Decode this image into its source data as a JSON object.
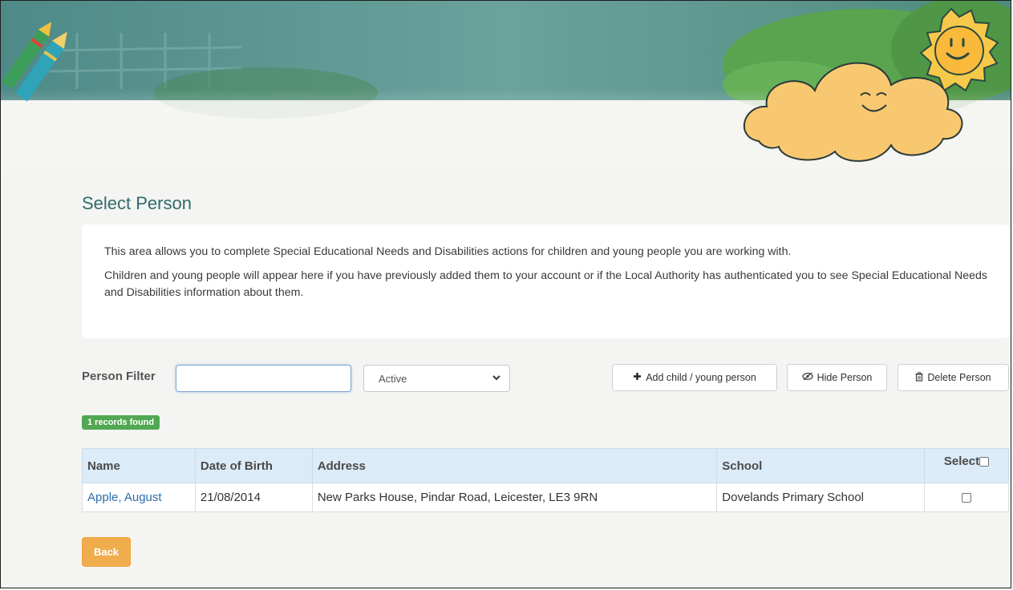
{
  "page": {
    "title": "Select Person",
    "info": [
      "This area allows you to complete Special Educational Needs and Disabilities actions for children and young people you are working with.",
      "Children and young people will appear here if you have previously added them to your account or if the Local Authority has authenticated you to see Special Educational Needs and Disabilities information about them."
    ]
  },
  "filter": {
    "label": "Person Filter",
    "value": "",
    "status_selected": "Active"
  },
  "actions": {
    "add_label": "Add child / young person",
    "hide_label": "Hide Person",
    "delete_label": "Delete Person"
  },
  "results": {
    "badge": "1 records found",
    "columns": [
      "Name",
      "Date of Birth",
      "Address",
      "School",
      "Select"
    ],
    "rows": [
      {
        "name": "Apple, August",
        "dob": "21/08/2014",
        "address": "New Parks House, Pindar Road, Leicester, LE3 9RN",
        "school": "Dovelands Primary School"
      }
    ]
  },
  "footer": {
    "back_label": "Back"
  },
  "icons": {
    "add": "plus-icon",
    "hide": "eye-slash-icon",
    "delete": "trash-icon",
    "select": "chevron-down-icon"
  },
  "colors": {
    "title": "#2f6b6b",
    "banner": "#5f9a94",
    "badge": "#52a852",
    "back_button": "#f0ad4e",
    "table_header": "#dcebf8",
    "link": "#2a6fad"
  }
}
